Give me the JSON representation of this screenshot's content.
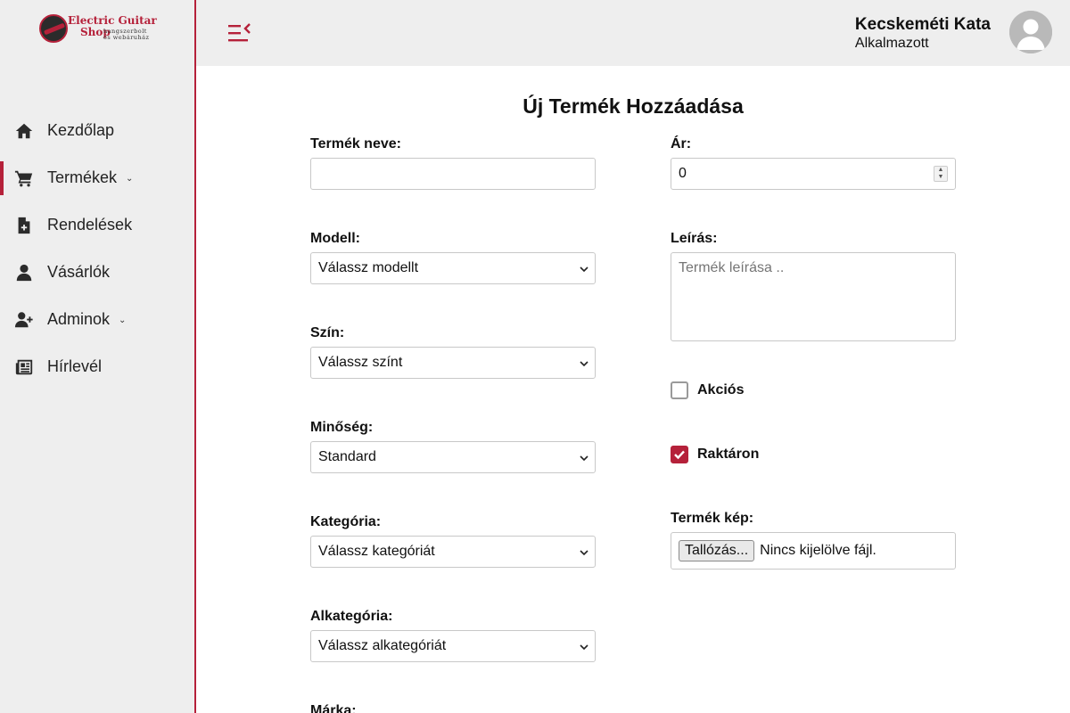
{
  "brand": {
    "name_line1": "Electric Guitar",
    "name_line2": "Shop",
    "tagline1": "hangszerbolt",
    "tagline2": "és webáruház"
  },
  "sidebar": {
    "items": [
      {
        "label": "Kezdőlap",
        "icon": "home-icon",
        "active": false,
        "has_caret": false
      },
      {
        "label": "Termékek",
        "icon": "cart-icon",
        "active": true,
        "has_caret": true
      },
      {
        "label": "Rendelések",
        "icon": "file-plus-icon",
        "active": false,
        "has_caret": false
      },
      {
        "label": "Vásárlók",
        "icon": "user-icon",
        "active": false,
        "has_caret": false
      },
      {
        "label": "Adminok",
        "icon": "user-plus-icon",
        "active": false,
        "has_caret": true
      },
      {
        "label": "Hírlevél",
        "icon": "newspaper-icon",
        "active": false,
        "has_caret": false
      }
    ]
  },
  "header": {
    "user_name": "Kecskeméti Kata",
    "user_role": "Alkalmazott"
  },
  "form": {
    "title": "Új Termék Hozzáadása",
    "name": {
      "label": "Termék neve:",
      "value": ""
    },
    "model": {
      "label": "Modell:",
      "selected": "Válassz modellt"
    },
    "color": {
      "label": "Szín:",
      "selected": "Válassz színt"
    },
    "quality": {
      "label": "Minőség:",
      "selected": "Standard"
    },
    "category": {
      "label": "Kategória:",
      "selected": "Válassz kategóriát"
    },
    "subcategory": {
      "label": "Alkategória:",
      "selected": "Válassz alkategóriát"
    },
    "brand_field": {
      "label": "Márka:"
    },
    "price": {
      "label": "Ár:",
      "value": "0"
    },
    "description": {
      "label": "Leírás:",
      "placeholder": "Termék leírása .."
    },
    "on_sale": {
      "label": "Akciós",
      "checked": false
    },
    "in_stock": {
      "label": "Raktáron",
      "checked": true
    },
    "image": {
      "label": "Termék kép:",
      "button": "Tallózás...",
      "status": "Nincs kijelölve fájl."
    }
  },
  "colors": {
    "accent": "#b5213a",
    "sidebar_bg": "#eeeeee"
  }
}
